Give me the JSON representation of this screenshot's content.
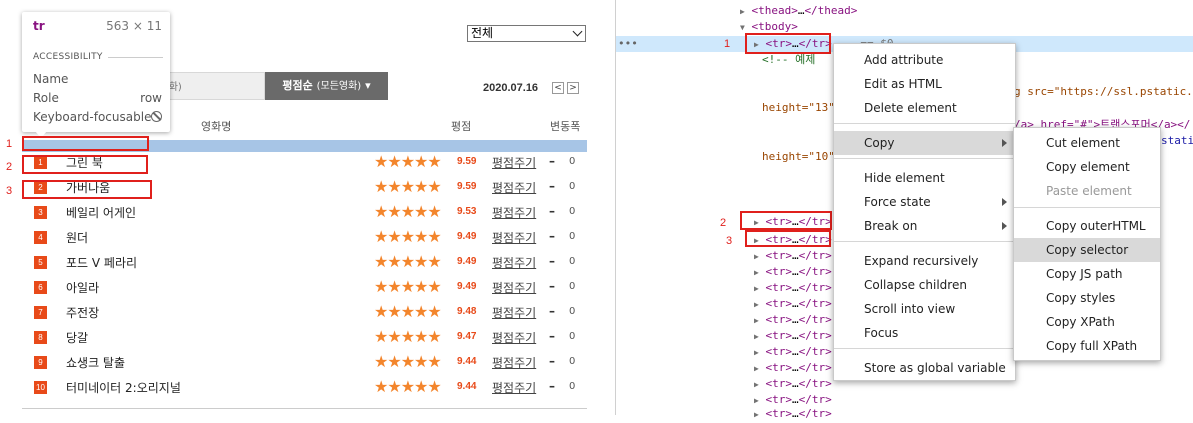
{
  "left": {
    "filter_value": "전체",
    "tabs": [
      {
        "label": "순",
        "small": "(현재상영영화)"
      },
      {
        "label": "평점순",
        "small": "(모든영화)",
        "suffix": "▾"
      }
    ],
    "date": "2020.07.16",
    "prev_btn": "<",
    "next_btn": ">",
    "columns": {
      "title": "영화명",
      "score": "평점",
      "change": "변동폭"
    },
    "movies": [
      {
        "rank": "1",
        "title": "그린 북",
        "score": "9.59",
        "rate": "평점주기",
        "dash": "–",
        "change": "0"
      },
      {
        "rank": "2",
        "title": "가버나움",
        "score": "9.59",
        "rate": "평점주기",
        "dash": "–",
        "change": "0"
      },
      {
        "rank": "3",
        "title": "베일리 어게인",
        "score": "9.53",
        "rate": "평점주기",
        "dash": "–",
        "change": "0"
      },
      {
        "rank": "4",
        "title": "원더",
        "score": "9.49",
        "rate": "평점주기",
        "dash": "–",
        "change": "0"
      },
      {
        "rank": "5",
        "title": "포드 V 페라리",
        "score": "9.49",
        "rate": "평점주기",
        "dash": "–",
        "change": "0"
      },
      {
        "rank": "6",
        "title": "아일라",
        "score": "9.49",
        "rate": "평점주기",
        "dash": "–",
        "change": "0"
      },
      {
        "rank": "7",
        "title": "주전장",
        "score": "9.48",
        "rate": "평점주기",
        "dash": "–",
        "change": "0"
      },
      {
        "rank": "8",
        "title": "당갈",
        "score": "9.47",
        "rate": "평점주기",
        "dash": "–",
        "change": "0"
      },
      {
        "rank": "9",
        "title": "쇼생크 탈출",
        "score": "9.44",
        "rate": "평점주기",
        "dash": "–",
        "change": "0"
      },
      {
        "rank": "10",
        "title": "터미네이터 2:오리지널",
        "score": "9.44",
        "rate": "평점주기",
        "dash": "–",
        "change": "0"
      }
    ],
    "stars": "★★★★★",
    "tooltip": {
      "tag": "tr",
      "dims": "563 × 11",
      "section": "ACCESSIBILITY",
      "rows": [
        {
          "k": "Name",
          "v": ""
        },
        {
          "k": "Role",
          "v": "row"
        },
        {
          "k": "Keyboard-focusable",
          "v": ""
        }
      ]
    },
    "annotations": [
      "1",
      "2",
      "3"
    ]
  },
  "right": {
    "gutter_dots": "•••",
    "lines": {
      "thead_open": "<thead>",
      "thead_ellipsis": "…",
      "thead_close": "</thead>",
      "tbody_open": "<tbody>",
      "tr_open": "<tr>",
      "tr_ellipsis": "…",
      "tr_close": "</tr>",
      "eq0": "== $0",
      "comment": "<!-- 예제",
      "img_frag": "g src=\"https://ssl.pstatic.",
      "height13": "height=\"13\"",
      "link_frag": "/a> href=\"#\">트랜스포머</a></",
      "height10": "height=\"10\"",
      "static_frag": "static."
    },
    "annotations": [
      "1",
      "2",
      "3"
    ],
    "menu": [
      {
        "label": "Add attribute"
      },
      {
        "label": "Edit as HTML"
      },
      {
        "label": "Delete element"
      },
      {
        "label": "Copy",
        "submenu": true,
        "active": true
      },
      {
        "label": "Hide element"
      },
      {
        "label": "Force state",
        "submenu": true
      },
      {
        "label": "Break on",
        "submenu": true
      },
      {
        "label": "Expand recursively"
      },
      {
        "label": "Collapse children"
      },
      {
        "label": "Scroll into view"
      },
      {
        "label": "Focus"
      },
      {
        "label": "Store as global variable"
      }
    ],
    "submenu": [
      {
        "label": "Cut element"
      },
      {
        "label": "Copy element"
      },
      {
        "label": "Paste element",
        "disabled": true
      },
      {
        "label": "Copy outerHTML"
      },
      {
        "label": "Copy selector",
        "active": true
      },
      {
        "label": "Copy JS path"
      },
      {
        "label": "Copy styles"
      },
      {
        "label": "Copy XPath"
      },
      {
        "label": "Copy full XPath"
      }
    ]
  }
}
